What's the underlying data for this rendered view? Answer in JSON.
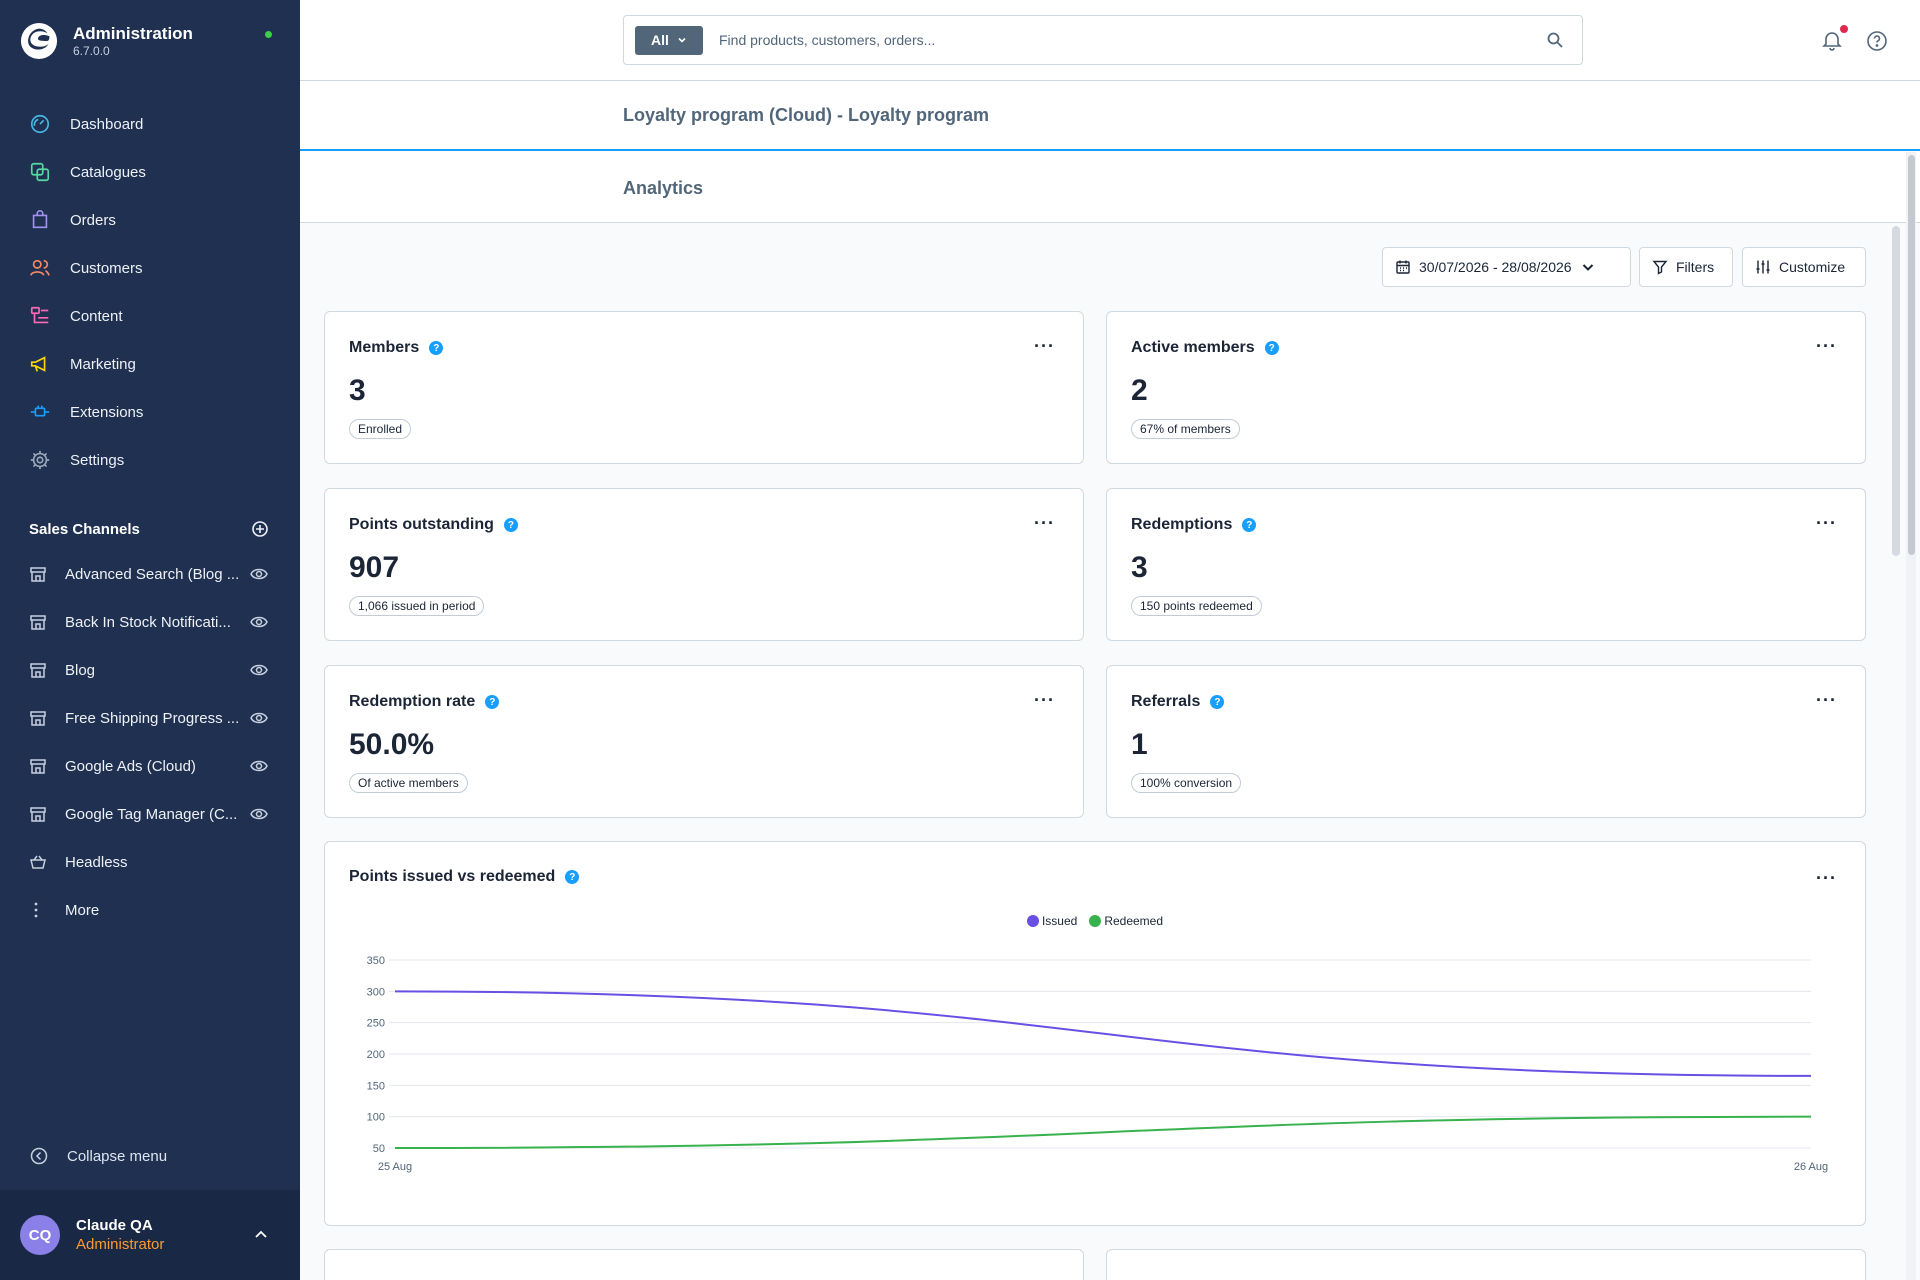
{
  "app": {
    "title": "Administration",
    "version": "6.7.0.0"
  },
  "nav": {
    "items": [
      {
        "label": "Dashboard",
        "icon": "gauge-icon"
      },
      {
        "label": "Catalogues",
        "icon": "catalogue-icon"
      },
      {
        "label": "Orders",
        "icon": "bag-icon"
      },
      {
        "label": "Customers",
        "icon": "users-icon"
      },
      {
        "label": "Content",
        "icon": "content-icon"
      },
      {
        "label": "Marketing",
        "icon": "megaphone-icon"
      },
      {
        "label": "Extensions",
        "icon": "plug-icon"
      },
      {
        "label": "Settings",
        "icon": "gear-icon"
      }
    ]
  },
  "channels": {
    "heading": "Sales Channels",
    "items": [
      {
        "label": "Advanced Search (Blog ..."
      },
      {
        "label": "Back In Stock Notificati..."
      },
      {
        "label": "Blog"
      },
      {
        "label": "Free Shipping Progress ..."
      },
      {
        "label": "Google Ads (Cloud)"
      },
      {
        "label": "Google Tag Manager (C..."
      }
    ],
    "headless": "Headless",
    "more": "More"
  },
  "sidebar": {
    "collapse_label": "Collapse menu"
  },
  "user": {
    "initials": "CQ",
    "name": "Claude QA",
    "role": "Administrator"
  },
  "search": {
    "scope": "All",
    "placeholder": "Find products, customers, orders..."
  },
  "page": {
    "title": "Loyalty program (Cloud) - Loyalty program",
    "tab": "Analytics"
  },
  "toolbar": {
    "date_range": "30/07/2026 - 28/08/2026",
    "filters": "Filters",
    "customize": "Customize"
  },
  "kpis": [
    {
      "title": "Members",
      "value": "3",
      "badge": "Enrolled"
    },
    {
      "title": "Active members",
      "value": "2",
      "badge": "67% of members"
    },
    {
      "title": "Points outstanding",
      "value": "907",
      "badge": "1,066 issued in period"
    },
    {
      "title": "Redemptions",
      "value": "3",
      "badge": "150 points redeemed"
    },
    {
      "title": "Redemption rate",
      "value": "50.0%",
      "badge": "Of active members"
    },
    {
      "title": "Referrals",
      "value": "1",
      "badge": "100% conversion"
    }
  ],
  "chart": {
    "title": "Points issued vs redeemed"
  },
  "colors": {
    "sidebar": "#1f3051",
    "accent": "#189eff",
    "issued": "#6a4fe4",
    "redeemed": "#37b24d",
    "role": "#ff9a2d"
  },
  "chart_data": {
    "type": "line",
    "title": "Points issued vs redeemed",
    "xlabel": "",
    "ylabel": "",
    "x": [
      "25 Aug",
      "26 Aug"
    ],
    "series": [
      {
        "name": "Issued",
        "values": [
          300,
          165
        ]
      },
      {
        "name": "Redeemed",
        "values": [
          50,
          100
        ]
      }
    ],
    "ylim": [
      50,
      350
    ],
    "yticks": [
      50,
      100,
      150,
      200,
      250,
      300,
      350
    ],
    "grid": true,
    "legend": "top-center"
  }
}
